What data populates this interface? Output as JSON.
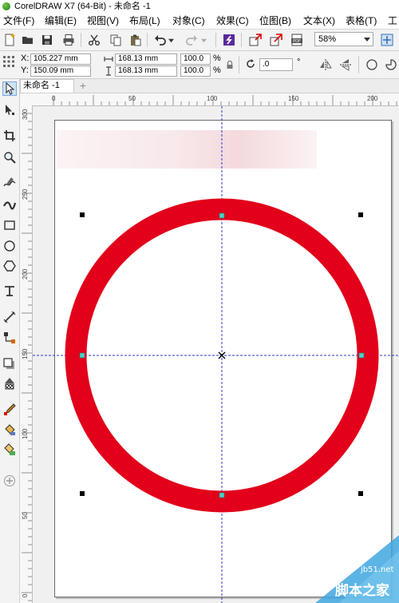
{
  "window": {
    "title": "CorelDRAW X7 (64-Bit) - 未命名 -1"
  },
  "menu": [
    "文件(F)",
    "编辑(E)",
    "视图(V)",
    "布局(L)",
    "对象(C)",
    "效果(C)",
    "位图(B)",
    "文本(X)",
    "表格(T)",
    "工"
  ],
  "toolbar": {
    "zoom": "58%"
  },
  "properties": {
    "x_label": "X:",
    "x_value": "105.227 mm",
    "y_label": "Y:",
    "y_value": "150.09 mm",
    "width_value": "168.13 mm",
    "height_value": "168.13 mm",
    "scale_x": "100.0",
    "scale_y": "100.0",
    "percent": "%",
    "rotation": ".0",
    "degree": "°"
  },
  "tabs": {
    "doc": "未命名 -1",
    "add": "+"
  },
  "ruler": {
    "top": [
      "0",
      "50",
      "100",
      "150",
      "200"
    ],
    "left": [
      "300",
      "250",
      "200",
      "150",
      "100",
      "50",
      "0"
    ]
  },
  "canvas": {
    "circle_stroke_color": "#e2001a"
  },
  "watermark": {
    "site": "jb51.net",
    "brand": "脚本之家"
  }
}
